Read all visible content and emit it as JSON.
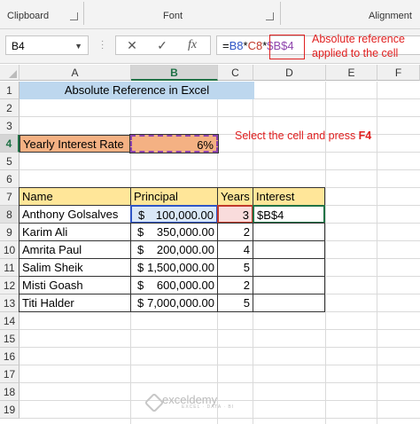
{
  "ribbon": {
    "clipboard": "Clipboard",
    "font": "Font",
    "alignment": "Alignment"
  },
  "formula_bar": {
    "name_box": "B4",
    "cancel": "✕",
    "enter": "✓",
    "fx": "fx",
    "formula_prefix": "=",
    "formula_ref1": "B8",
    "formula_op1": "*",
    "formula_ref2": "C8",
    "formula_op2": "*",
    "formula_ref3": "$B$4"
  },
  "annotations": {
    "callout_line1": "Absolute reference",
    "callout_line2": "applied to the cell",
    "instruction_prefix": "Select the cell and press ",
    "instruction_key": "F4"
  },
  "columns": [
    "A",
    "B",
    "C",
    "D",
    "E",
    "F"
  ],
  "rows": [
    "1",
    "2",
    "3",
    "4",
    "5",
    "6",
    "7",
    "8",
    "9",
    "10",
    "11",
    "12",
    "13",
    "14",
    "15",
    "16",
    "17",
    "18",
    "19"
  ],
  "sheet": {
    "title": "Absolute Reference in Excel",
    "rate_label": "Yearly Interest Rate",
    "rate_value": "6%",
    "headers": {
      "name": "Name",
      "principal": "Principal",
      "years": "Years",
      "interest": "Interest"
    },
    "data": [
      {
        "name": "Anthony Golsalves",
        "principal": "100,000.00",
        "years": "3",
        "interest": "$B$4"
      },
      {
        "name": "Karim Ali",
        "principal": "350,000.00",
        "years": "2",
        "interest": ""
      },
      {
        "name": "Amrita Paul",
        "principal": "200,000.00",
        "years": "4",
        "interest": ""
      },
      {
        "name": "Salim Sheik",
        "principal": "1,500,000.00",
        "years": "5",
        "interest": ""
      },
      {
        "name": "Misti Goash",
        "principal": "600,000.00",
        "years": "2",
        "interest": ""
      },
      {
        "name": "Titi Halder",
        "principal": "7,000,000.00",
        "years": "5",
        "interest": ""
      }
    ],
    "currency": "$"
  },
  "watermark": {
    "name": "exceldemy",
    "tagline": "EXCEL · DATA · BI"
  },
  "colors": {
    "title_fill": "#bdd7ee",
    "rate_fill": "#f4b183",
    "header_fill": "#ffe699",
    "accent_red": "#e02020",
    "excel_green": "#217346"
  }
}
